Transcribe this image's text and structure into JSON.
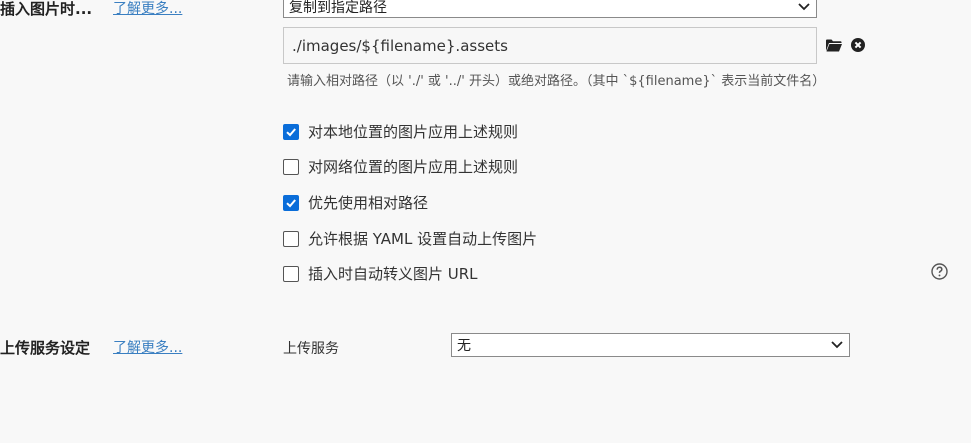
{
  "image_insert": {
    "section_title": "插入图片时...",
    "learn_more": "了解更多...",
    "action_select": "复制到指定路径",
    "path_value": "./images/${filename}.assets",
    "hint": "请输入相对路径（以 './' 或 '../' 开头）或绝对路径。（其中 `${filename}` 表示当前文件名）",
    "options": [
      {
        "label": "对本地位置的图片应用上述规则",
        "checked": true
      },
      {
        "label": "对网络位置的图片应用上述规则",
        "checked": false
      },
      {
        "label": "优先使用相对路径",
        "checked": true
      },
      {
        "label": "允许根据 YAML 设置自动上传图片",
        "checked": false
      },
      {
        "label": "插入时自动转义图片 URL",
        "checked": false
      }
    ]
  },
  "upload": {
    "section_title": "上传服务设定",
    "learn_more": "了解更多...",
    "service_label": "上传服务",
    "service_select": "无"
  },
  "colors": {
    "accent": "#0a6dd9",
    "link": "#3a7fc1"
  },
  "icons": [
    "folder-icon",
    "clear-icon",
    "help-icon",
    "chevron-down-icon"
  ]
}
